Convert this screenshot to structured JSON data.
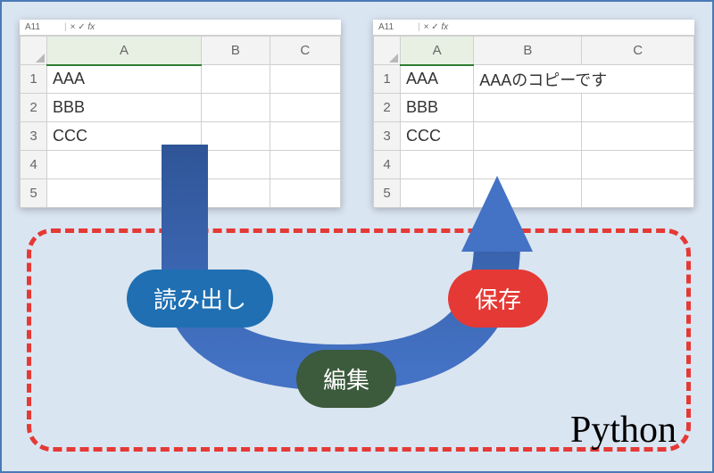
{
  "cellref": "A11",
  "fx_symbol": "fx",
  "columns": [
    "A",
    "B",
    "C"
  ],
  "row_numbers": [
    "1",
    "2",
    "3",
    "4",
    "5"
  ],
  "left_sheet": {
    "rows": [
      {
        "A": "AAA",
        "B": "",
        "C": ""
      },
      {
        "A": "BBB",
        "B": "",
        "C": ""
      },
      {
        "A": "CCC",
        "B": "",
        "C": ""
      },
      {
        "A": "",
        "B": "",
        "C": ""
      },
      {
        "A": "",
        "B": "",
        "C": ""
      }
    ]
  },
  "right_sheet": {
    "rows": [
      {
        "A": "AAA",
        "B": "AAAのコピーです",
        "C": ""
      },
      {
        "A": "BBB",
        "B": "",
        "C": ""
      },
      {
        "A": "CCC",
        "B": "",
        "C": ""
      },
      {
        "A": "",
        "B": "",
        "C": ""
      },
      {
        "A": "",
        "B": "",
        "C": ""
      }
    ]
  },
  "labels": {
    "read": "読み出し",
    "edit": "編集",
    "save": "保存",
    "python": "Python"
  },
  "colors": {
    "bg": "#dae5f2",
    "border": "#4a7ab5",
    "dash": "#e53935",
    "arrow_dark": "#2f5597",
    "arrow_mid": "#3b66a6",
    "pill_read": "#1f6fb2",
    "pill_edit": "#3c5a3c",
    "pill_save": "#e53935"
  }
}
